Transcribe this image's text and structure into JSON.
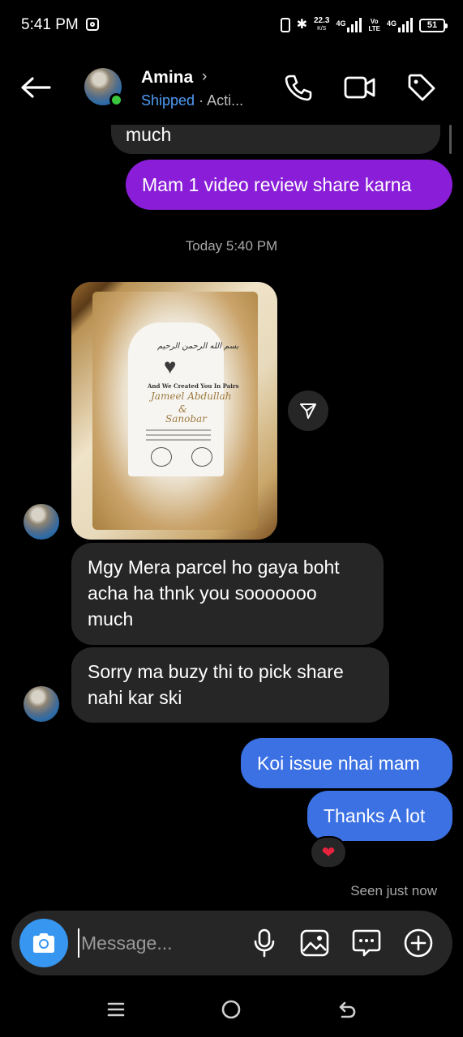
{
  "status_bar": {
    "time": "5:41 PM",
    "speed_value": "22.3",
    "speed_unit": "K/S",
    "net1_label": "4G",
    "volte_top": "Vo",
    "volte_bottom": "LTE",
    "net2_label": "4G",
    "battery": "51"
  },
  "header": {
    "contact_name": "Amina",
    "label": "Shipped",
    "status": "· Acti...",
    "icons": [
      "back-arrow-icon",
      "phone-icon",
      "video-icon",
      "tag-icon"
    ]
  },
  "messages": {
    "prev_partial": "much",
    "outgoing_1": "Mam 1 video review share karna",
    "timestamp": "Today 5:40 PM",
    "incoming_1": "Mgy Mera parcel ho gaya boht acha ha thnk you sooooooo much",
    "incoming_2": "Sorry ma buzy thi to pick share nahi kar ski",
    "outgoing_2": "Koi issue nhai mam",
    "outgoing_3": "Thanks A lot",
    "reaction": "❤",
    "seen_status": "Seen just now"
  },
  "photo_card": {
    "arabic": "بسم الله الرحمن الرحيم",
    "line1": "And We Created You In Pairs",
    "name1": "Jameel Abdullah",
    "and": "&",
    "name2": "Sanobar"
  },
  "composer": {
    "placeholder": "Message...",
    "icons": [
      "camera-icon",
      "microphone-icon",
      "gallery-icon",
      "sticker-icon",
      "plus-icon"
    ]
  },
  "colors": {
    "background": "#000000",
    "incoming_bubble": "#262626",
    "outgoing_purple": "#8a1ed8",
    "outgoing_blue": "#3c71e4",
    "accent_blue": "#3797f0",
    "online_green": "#3ac73d"
  }
}
